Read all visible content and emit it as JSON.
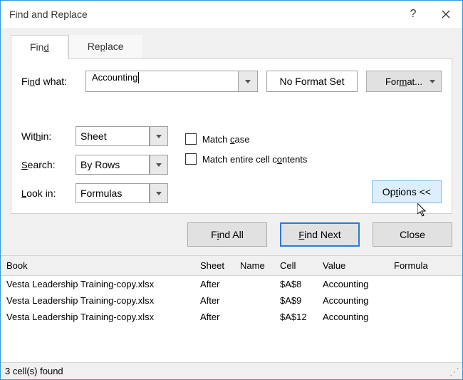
{
  "title": "Find and Replace",
  "tabs": {
    "find": "Find",
    "replace": "Replace"
  },
  "labels": {
    "find_what": "Find what:",
    "no_format": "No Format Set",
    "format": "Format...",
    "within": "Within:",
    "search": "Search:",
    "look_in": "Look in:",
    "match_case": "Match case",
    "match_entire": "Match entire cell contents",
    "options": "Options <<",
    "find_all": "Find All",
    "find_next": "Find Next",
    "close": "Close"
  },
  "inputs": {
    "find_value": "Accounting",
    "within_value": "Sheet",
    "search_value": "By Rows",
    "look_in_value": "Formulas"
  },
  "headers": {
    "book": "Book",
    "sheet": "Sheet",
    "name": "Name",
    "cell": "Cell",
    "value": "Value",
    "formula": "Formula"
  },
  "rows": [
    {
      "book": "Vesta Leadership Training-copy.xlsx",
      "sheet": "After",
      "name": "",
      "cell": "$A$8",
      "value": "Accounting",
      "formula": ""
    },
    {
      "book": "Vesta Leadership Training-copy.xlsx",
      "sheet": "After",
      "name": "",
      "cell": "$A$9",
      "value": "Accounting",
      "formula": ""
    },
    {
      "book": "Vesta Leadership Training-copy.xlsx",
      "sheet": "After",
      "name": "",
      "cell": "$A$12",
      "value": "Accounting",
      "formula": ""
    }
  ],
  "status": "3 cell(s) found"
}
